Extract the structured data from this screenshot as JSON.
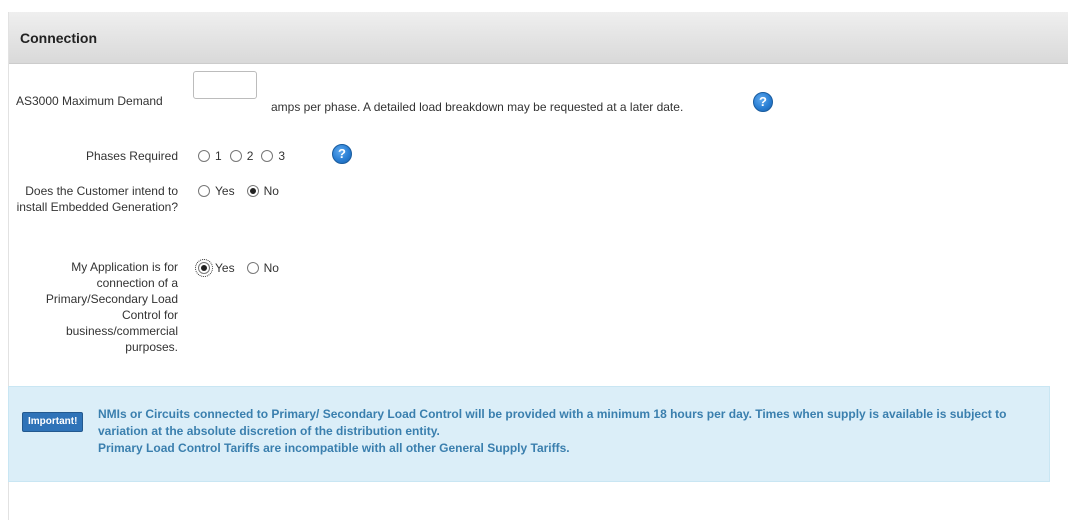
{
  "section": {
    "title": "Connection"
  },
  "max_demand": {
    "label": "AS3000 Maximum Demand",
    "value": "",
    "suffix": "amps per phase. A detailed load breakdown may be requested at a later date."
  },
  "phases": {
    "label": "Phases Required",
    "options": [
      {
        "label": "1",
        "checked": false
      },
      {
        "label": "2",
        "checked": false
      },
      {
        "label": "3",
        "checked": false
      }
    ]
  },
  "embedded_generation": {
    "label": "Does the Customer intend to install Embedded Generation?",
    "options": [
      {
        "label": "Yes",
        "checked": false
      },
      {
        "label": "No",
        "checked": true
      }
    ]
  },
  "load_control": {
    "label": "My Application is for connection of a Primary/Secondary Load Control for business/commercial purposes.",
    "options": [
      {
        "label": "Yes",
        "checked": true
      },
      {
        "label": "No",
        "checked": false
      }
    ]
  },
  "alert": {
    "badge": "Important!",
    "line1": "NMIs or Circuits connected to Primary/ Secondary Load Control will be provided with a minimum 18 hours per day. Times when supply is available is subject to variation at the absolute discretion of the distribution entity.",
    "line2": "Primary Load Control Tariffs are incompatible with all other General Supply Tariffs."
  },
  "help_icon_glyph": "?",
  "colors": {
    "help_icon": "#2a7fd4",
    "alert_background": "#dbeef8",
    "alert_text": "#3a7fae",
    "badge_background": "#2f73b8"
  }
}
